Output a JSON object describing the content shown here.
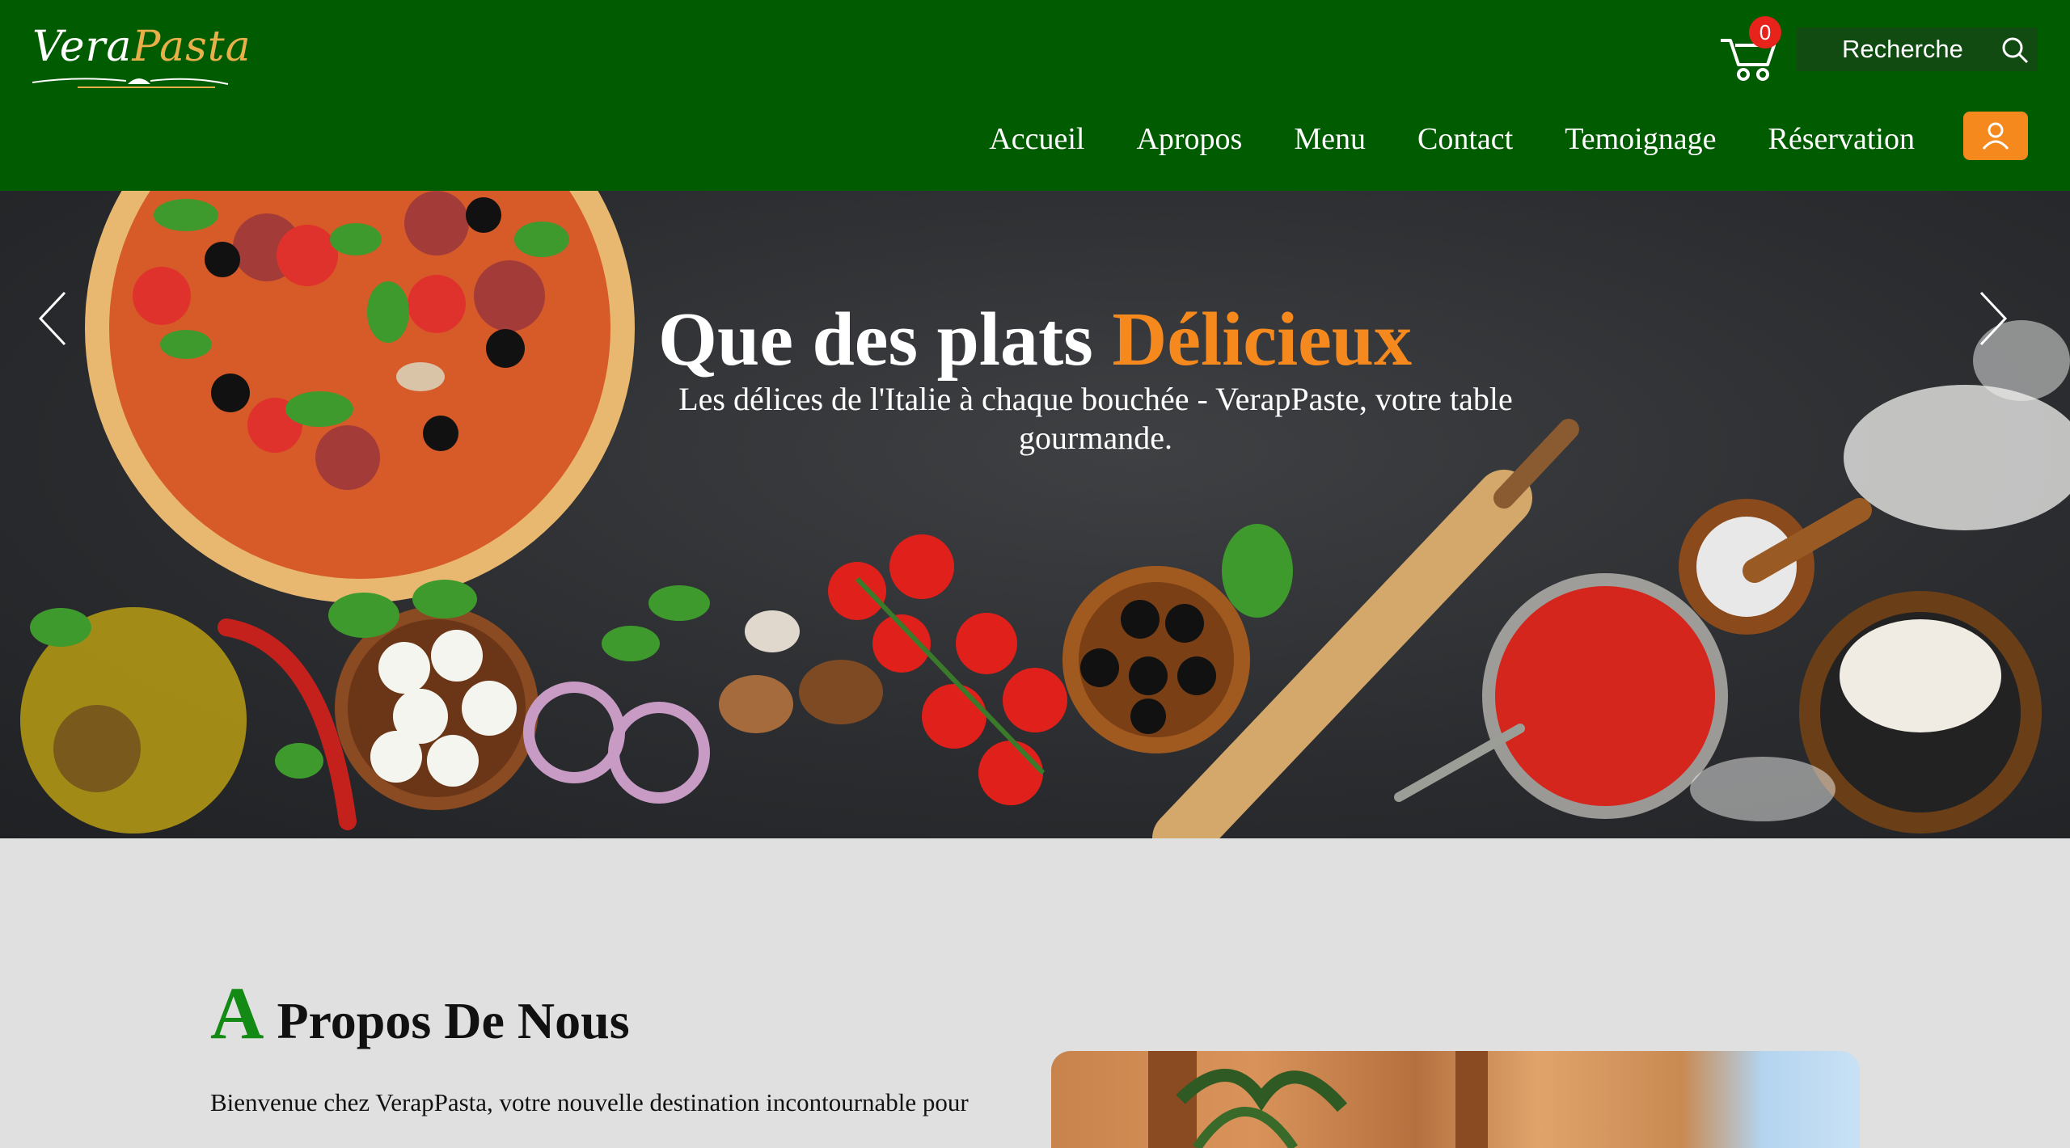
{
  "header": {
    "logo": {
      "text_part1": "Vera",
      "text_part2": "Pasta"
    },
    "cart": {
      "count": "0"
    },
    "search": {
      "placeholder": "Recherche"
    },
    "nav": {
      "items": [
        {
          "label": "Accueil"
        },
        {
          "label": "Apropos"
        },
        {
          "label": "Menu"
        },
        {
          "label": "Contact"
        },
        {
          "label": "Temoignage"
        },
        {
          "label": "Réservation"
        }
      ]
    }
  },
  "hero": {
    "title_part1": "Que des plats ",
    "title_part2": "Délicieux",
    "subtitle": "Les délices de l'Italie à chaque bouchée - VerapPaste, votre table gourmande."
  },
  "about": {
    "title_initial": "A",
    "title_rest": " Propos De Nous",
    "text": "Bienvenue chez VerapPasta, votre nouvelle destination incontournable pour"
  },
  "colors": {
    "header_bg": "#015c01",
    "accent_orange": "#f5891e",
    "badge_red": "#e8231c",
    "title_green": "#138a13"
  }
}
